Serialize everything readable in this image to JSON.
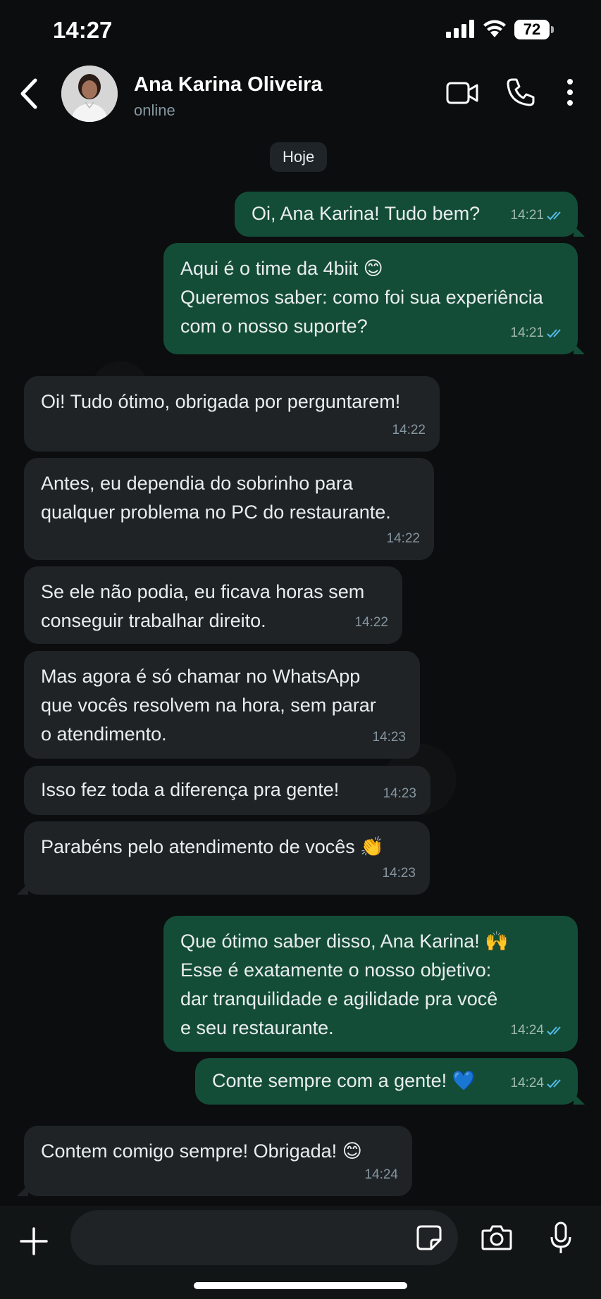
{
  "status_bar": {
    "time": "14:27",
    "battery": "72"
  },
  "header": {
    "contact_name": "Ana Karina Oliveira",
    "contact_status": "online"
  },
  "date_chip": "Hoje",
  "messages": [
    {
      "dir": "out",
      "text": "Oi, Ana Karina! Tudo bem?",
      "time": "14:21",
      "read": true
    },
    {
      "dir": "out",
      "text": "Aqui é o time da 4biit 😊\nQueremos saber: como foi sua experiência\ncom o nosso suporte?",
      "time": "14:21",
      "read": true
    },
    {
      "dir": "in",
      "text": "Oi! Tudo ótimo, obrigada por perguntarem!",
      "time": "14:22"
    },
    {
      "dir": "in",
      "text": "Antes, eu dependia do sobrinho para\nqualquer problema no PC do restaurante.",
      "time": "14:22"
    },
    {
      "dir": "in",
      "text": "Se ele não podia, eu ficava horas sem\nconseguir trabalhar direito.",
      "time": "14:22"
    },
    {
      "dir": "in",
      "text": "Mas agora é só chamar no WhatsApp\nque vocês resolvem na hora, sem parar\no atendimento.",
      "time": "14:23"
    },
    {
      "dir": "in",
      "text": "Isso fez toda a diferença pra gente!",
      "time": "14:23"
    },
    {
      "dir": "in",
      "text": "Parabéns pelo atendimento de vocês 👏",
      "time": "14:23"
    },
    {
      "dir": "out",
      "text": "Que ótimo saber disso, Ana Karina! 🙌\nEsse é exatamente o nosso objetivo:\ndar tranquilidade e agilidade pra você\ne seu restaurante.",
      "time": "14:24",
      "read": true
    },
    {
      "dir": "out",
      "text": "Conte sempre com a gente! 💙",
      "time": "14:24",
      "read": true
    },
    {
      "dir": "in",
      "text": "Contem comigo sempre! Obrigada! 😊",
      "time": "14:24"
    }
  ],
  "input": {
    "placeholder": ""
  },
  "colors": {
    "outgoing_bubble": "#144d37",
    "incoming_bubble": "#1f2326",
    "read_ticks": "#53bdeb",
    "background": "#0b0d0e"
  }
}
